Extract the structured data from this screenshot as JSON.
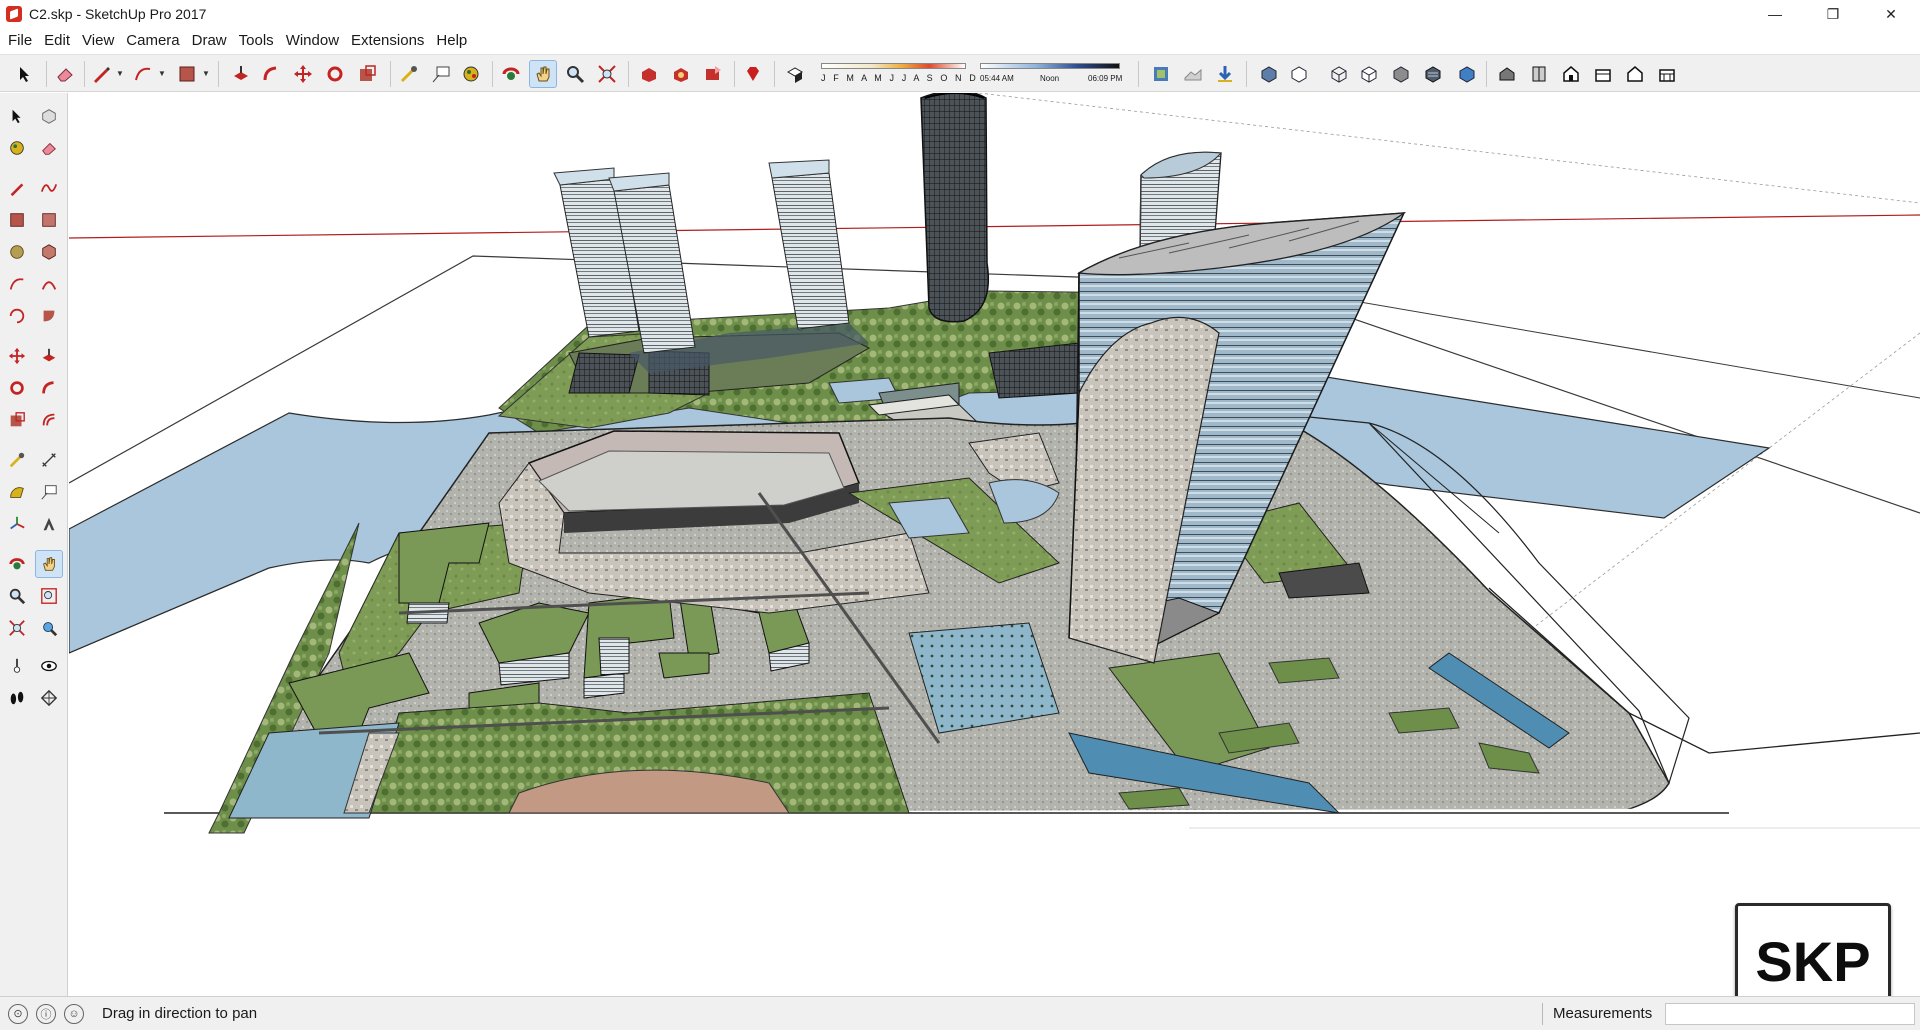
{
  "window": {
    "title": "C2.skp - SketchUp Pro 2017",
    "minimize": "—",
    "restore": "❐",
    "close": "✕"
  },
  "menu": [
    "File",
    "Edit",
    "View",
    "Camera",
    "Draw",
    "Tools",
    "Window",
    "Extensions",
    "Help"
  ],
  "shadows": {
    "months": "J F M A M J J A S O N D",
    "time_start": "05:44 AM",
    "time_mid": "Noon",
    "time_end": "06:09 PM"
  },
  "active_tool": "pan",
  "status": {
    "message": "Drag in direction to pan",
    "measurements_label": "Measurements",
    "measurements_value": ""
  },
  "watermark": "SKP",
  "colors": {
    "water": "#a9c6dc",
    "grass": "#7c9b56",
    "plaza": "#b7b7b1",
    "tower_glass": "#9db6c9",
    "red_axis": "#b11d1d"
  }
}
